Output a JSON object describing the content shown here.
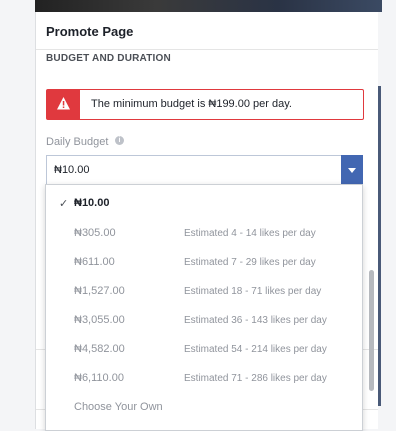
{
  "header": {
    "title": "Promote Page"
  },
  "section": {
    "title": "BUDGET AND DURATION"
  },
  "alert": {
    "message": "The minimum budget is ₦199.00 per day."
  },
  "budget": {
    "label": "Daily Budget",
    "info_icon": "i",
    "value": "₦10.00"
  },
  "dropdown": {
    "selected_check": "✓",
    "options": [
      {
        "amount": "₦10.00",
        "estimate": ""
      },
      {
        "amount": "₦305.00",
        "estimate": "Estimated 4 - 14 likes per day"
      },
      {
        "amount": "₦611.00",
        "estimate": "Estimated 7 - 29 likes per day"
      },
      {
        "amount": "₦1,527.00",
        "estimate": "Estimated 18 - 71 likes per day"
      },
      {
        "amount": "₦3,055.00",
        "estimate": "Estimated 36 - 143 likes per day"
      },
      {
        "amount": "₦4,582.00",
        "estimate": "Estimated 54 - 214 likes per day"
      },
      {
        "amount": "₦6,110.00",
        "estimate": "Estimated 71 - 286 likes per day"
      },
      {
        "amount": "Choose Your Own",
        "estimate": ""
      }
    ]
  },
  "colors": {
    "alert_red": "#e0393e",
    "brand_blue": "#4267b2"
  },
  "icons": {
    "alert": "warning-icon",
    "select": "chevron-down-icon",
    "check": "check-icon"
  }
}
